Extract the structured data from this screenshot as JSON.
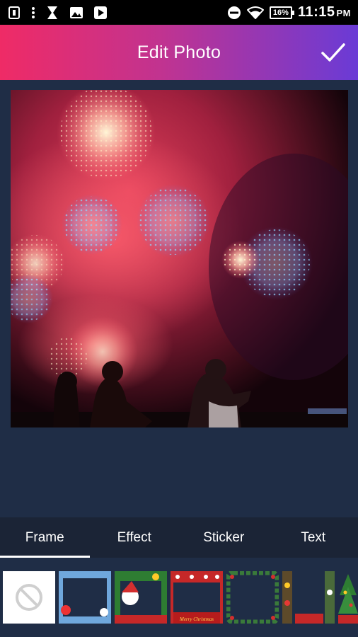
{
  "status_bar": {
    "time": "11:15",
    "ampm": "PM",
    "battery": "16%",
    "icons": [
      "sim-icon",
      "menu-dots-icon",
      "hourglass-icon",
      "gallery-icon",
      "play-store-icon",
      "do-not-disturb-icon",
      "wifi-icon",
      "battery-icon"
    ]
  },
  "header": {
    "title": "Edit Photo",
    "confirm_icon": "checkmark-icon",
    "gradient": [
      "#ef2b66",
      "#c13390",
      "#6a3bd6"
    ]
  },
  "photo": {
    "subject": "fireworks-photo"
  },
  "tabs": [
    {
      "label": "Frame",
      "active": true
    },
    {
      "label": "Effect",
      "active": false
    },
    {
      "label": "Sticker",
      "active": false
    },
    {
      "label": "Text",
      "active": false
    }
  ],
  "frames": {
    "items": [
      "no-frame",
      "blue-snowflake-frame",
      "santa-frame",
      "merry-christmas-frame",
      "holly-wreath-frame",
      "ornament-frame",
      "christmas-tree-frame"
    ],
    "banner_text": "Merry Christmas"
  },
  "colors": {
    "background": "#1f2d46",
    "tab_bar": "#1b2436",
    "status_bar": "#000000"
  }
}
